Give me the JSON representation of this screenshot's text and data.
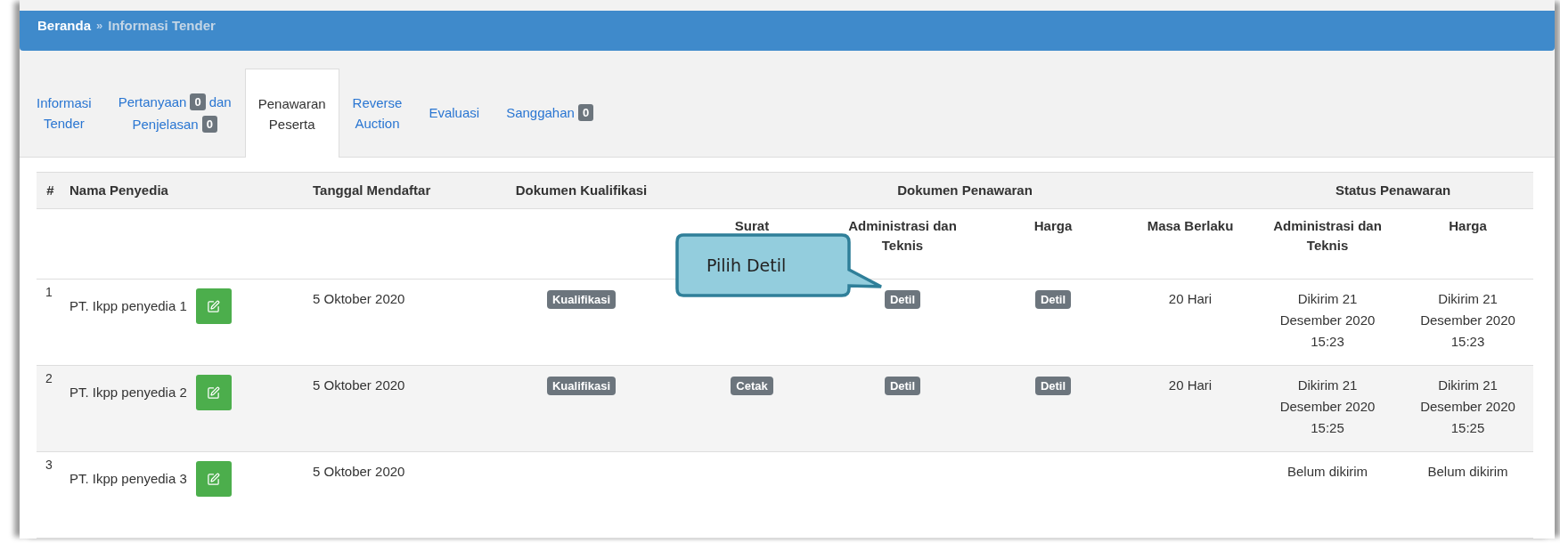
{
  "breadcrumb": {
    "home": "Beranda",
    "separator": "»",
    "current": "Informasi Tender"
  },
  "tabs": [
    {
      "selected": false,
      "lines": [
        [
          {
            "kind": "text",
            "text": "Informasi"
          }
        ],
        [
          {
            "kind": "text",
            "text": "Tender"
          }
        ]
      ]
    },
    {
      "selected": false,
      "lines": [
        [
          {
            "kind": "text",
            "text": "Pertanyaan"
          },
          {
            "kind": "badge",
            "text": "0"
          },
          {
            "kind": "text",
            "text": "dan"
          }
        ],
        [
          {
            "kind": "text",
            "text": "Penjelasan"
          },
          {
            "kind": "badge",
            "text": "0"
          }
        ]
      ]
    },
    {
      "selected": true,
      "lines": [
        [
          {
            "kind": "text",
            "text": "Penawaran"
          }
        ],
        [
          {
            "kind": "text",
            "text": "Peserta"
          }
        ]
      ]
    },
    {
      "selected": false,
      "lines": [
        [
          {
            "kind": "text",
            "text": "Reverse"
          }
        ],
        [
          {
            "kind": "text",
            "text": "Auction"
          }
        ]
      ]
    },
    {
      "selected": false,
      "lines": [
        [
          {
            "kind": "text",
            "text": "Evaluasi"
          }
        ]
      ]
    },
    {
      "selected": false,
      "lines": [
        [
          {
            "kind": "text",
            "text": "Sanggahan"
          },
          {
            "kind": "badge",
            "text": "0"
          }
        ]
      ]
    }
  ],
  "table": {
    "group_headers": [
      "#",
      "Nama Penyedia",
      "Tanggal Mendaftar",
      "Dokumen Kualifikasi",
      "Dokumen Penawaran",
      "Status Penawaran"
    ],
    "sub_headers": [
      "Surat",
      "Administrasi dan Teknis",
      "Harga",
      "Masa Berlaku",
      "Administrasi dan Teknis",
      "Harga"
    ],
    "rows": [
      {
        "number": "1",
        "name": "PT. Ikpp penyedia 1",
        "date": "5 Oktober 2020",
        "kualifikasi": "Kualifikasi",
        "administrasi": "Detil",
        "harga": "Detil",
        "masa": "20 Hari",
        "status_administrasi": "Dikirim 21 Desember 2020 15:23",
        "status_harga": "Dikirim 21 Desember 2020 15:23"
      },
      {
        "number": "2",
        "name": "PT. Ikpp penyedia 2",
        "date": "5 Oktober 2020",
        "kualifikasi": "Kualifikasi",
        "surat": "Cetak",
        "administrasi": "Detil",
        "harga": "Detil",
        "masa": "20 Hari",
        "status_administrasi": "Dikirim 21 Desember 2020 15:25",
        "status_harga": "Dikirim 21 Desember 2020 15:25"
      },
      {
        "number": "3",
        "name": "PT. Ikpp penyedia 3",
        "date": "5 Oktober 2020",
        "status_administrasi": "Belum dikirim",
        "status_harga": "Belum dikirim"
      }
    ]
  },
  "callout": {
    "text": "Pilih Detil"
  }
}
